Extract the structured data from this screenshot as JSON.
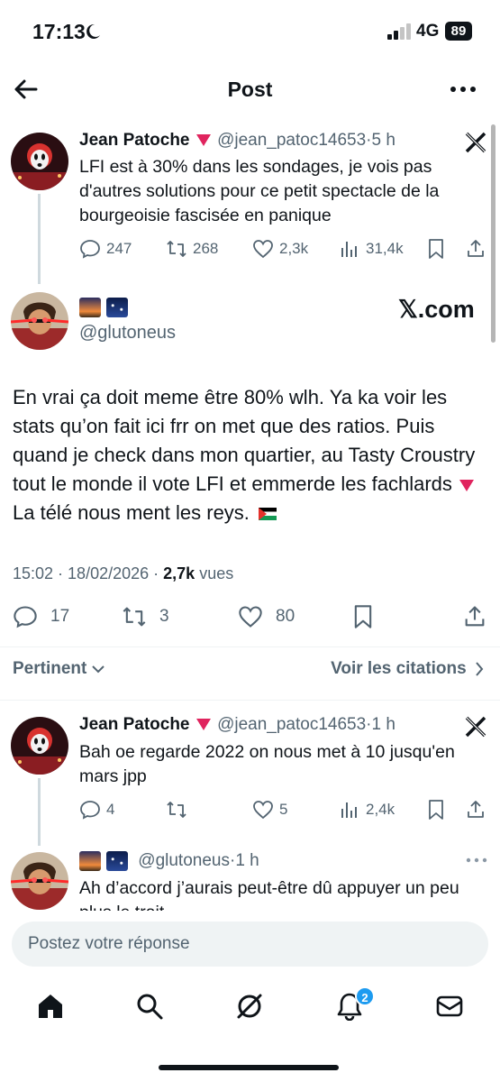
{
  "status_bar": {
    "time": "17:13",
    "network": "4G",
    "battery": "89"
  },
  "nav": {
    "title": "Post"
  },
  "parent_tweet": {
    "name": "Jean Patoche",
    "handle": "@jean_patoc14653",
    "time": "5 h",
    "text": "LFI est à 30% dans les sondages, je vois pas d'autres solutions pour ce petit spectacle de la bourgeoisie fascisée en panique",
    "replies": "247",
    "retweets": "268",
    "likes": "2,3k",
    "views": "31,4k"
  },
  "main_tweet": {
    "handle": "@glutoneus",
    "watermark": "𝕏.com",
    "text_part1": "En vrai ça doit meme être 80% wlh. Ya ka voir les stats qu’on fait ici frr on met que des ratios. Puis quand je check dans mon quartier, au Tasty Croustry tout le monde il vote LFI et emmerde les fachlards",
    "text_part2": "La télé nous ment les reys.",
    "time": "15:02",
    "date": "18/02/2026",
    "views_count": "2,7k",
    "views_label": "vues",
    "replies": "17",
    "retweets": "3",
    "likes": "80"
  },
  "sort": {
    "label": "Pertinent",
    "quotes_link": "Voir les citations"
  },
  "reply_1": {
    "name": "Jean Patoche",
    "handle": "@jean_patoc14653",
    "time": "1 h",
    "text": "Bah oe regarde 2022 on nous met à 10 jusqu'en mars jpp",
    "replies": "4",
    "likes": "5",
    "views": "2,4k"
  },
  "reply_2": {
    "handle": "@glutoneus",
    "time": "1 h",
    "text": "Ah d’accord j’aurais peut-être dû appuyer un peu plus le trait"
  },
  "composer": {
    "placeholder": "Postez votre réponse"
  },
  "tab_bar": {
    "notifications_badge": "2"
  },
  "icons": [
    "back-arrow-icon",
    "more-icon",
    "x-logo-icon",
    "reply-icon",
    "retweet-icon",
    "like-icon",
    "views-icon",
    "bookmark-icon",
    "share-icon",
    "home-icon",
    "search-icon",
    "grok-icon",
    "bell-icon",
    "mail-icon"
  ]
}
